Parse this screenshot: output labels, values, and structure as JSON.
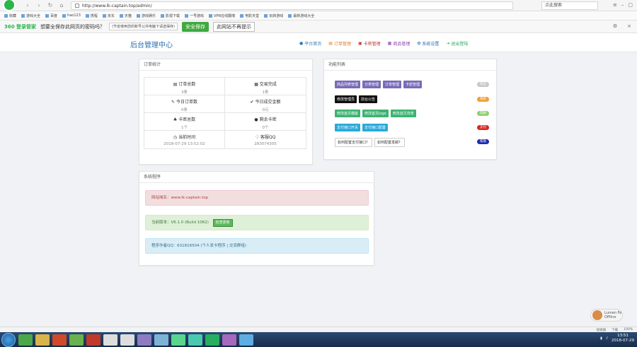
{
  "browser": {
    "url": "http://www.lk-captain.top/admin/",
    "search_placeholder": "点此搜索",
    "bookmarks": [
      "收藏",
      "游戏大全",
      "百度",
      "hao123",
      "携程",
      "京东",
      "天猫",
      "游戏娱乐",
      "影视下载",
      "一号游戏",
      "VPN在线翻墙",
      "电影天堂",
      "玩转游戏",
      "最新游戏大全"
    ],
    "password_bar": {
      "brand": "360 登录管家",
      "question": "想要全保存此网页的密码吗？",
      "hint": "(节省使用您的账号公共电脑下请选保存)",
      "save_label": "安全保存",
      "never_label": "此网站不再提示"
    },
    "zoom": "100%",
    "status_text": "加速器",
    "downloads": "下载"
  },
  "admin": {
    "title": "后台管理中心",
    "nav": [
      {
        "label": "平台首页",
        "color": "#337ab7",
        "icon": "user-icon"
      },
      {
        "label": "订单管理",
        "color": "#e67e22",
        "icon": "order-icon"
      },
      {
        "label": "卡密管理",
        "color": "#c0392b",
        "icon": "card-icon"
      },
      {
        "label": "商品管理",
        "color": "#8e44ad",
        "icon": "goods-icon"
      },
      {
        "label": "系统设置",
        "color": "#2c6fb1",
        "icon": "gear-icon"
      },
      {
        "label": "退出登陆",
        "color": "#27ae60",
        "icon": "logout-icon"
      }
    ]
  },
  "orders_panel": {
    "title": "订单统计",
    "stats": [
      {
        "label": "订单总数",
        "value": "3条",
        "icon": "list-icon"
      },
      {
        "label": "交易完成",
        "value": "1条",
        "icon": "cart-icon"
      },
      {
        "label": "今日订单数",
        "value": "0条",
        "icon": "pen-icon"
      },
      {
        "label": "今日成交金额",
        "value": "0元",
        "icon": "check-icon"
      },
      {
        "label": "卡密总数",
        "value": "1个",
        "icon": "card-icon"
      },
      {
        "label": "剩余卡密",
        "value": "0个",
        "icon": "dot-icon"
      },
      {
        "label": "当前时间",
        "value": "2018-07-29 13:52:02",
        "icon": "clock-icon"
      },
      {
        "label": "客服QQ",
        "value": "283074305",
        "icon": "heart-icon"
      }
    ]
  },
  "functions_panel": {
    "title": "功能列表",
    "rows": [
      {
        "buttons": [
          {
            "label": "商品列表管理",
            "color": "#7a6bb8"
          },
          {
            "label": "分类管理",
            "color": "#7a6bb8"
          },
          {
            "label": "订单管理",
            "color": "#7a6bb8"
          },
          {
            "label": "卡密管理",
            "color": "#7a6bb8"
          }
        ],
        "badge": "商品",
        "badge_color": "#c8c8c8"
      },
      {
        "buttons": [
          {
            "label": "修改管理员",
            "color": "#111111"
          },
          {
            "label": "前台公告",
            "color": "#111111"
          }
        ],
        "badge": "系统",
        "badge_color": "#f0a030"
      },
      {
        "buttons": [
          {
            "label": "修改首页模版",
            "color": "#3cb371"
          },
          {
            "label": "修改首页logo",
            "color": "#3cb371"
          },
          {
            "label": "修改首页背景",
            "color": "#3cb371"
          }
        ],
        "badge": "风格",
        "badge_color": "#8fcf6f"
      },
      {
        "buttons": [
          {
            "label": "支付接口开关",
            "color": "#29a9d8"
          },
          {
            "label": "支付接口配置",
            "color": "#29a9d8"
          }
        ],
        "badge": "支付",
        "badge_color": "#d9281f"
      },
      {
        "buttons": [
          {
            "label": "如何配置支付接口？",
            "color": "#ffffff"
          },
          {
            "label": "如何配置发邮？",
            "color": "#ffffff"
          }
        ],
        "badge": "帮助",
        "badge_color": "#1f2bb0"
      }
    ]
  },
  "sysinfo_panel": {
    "title": "系统程序",
    "domain_text": "网站域名：www.lk-captain.top",
    "version_text": "当前版本：V6.1.0 (Build 1062)",
    "update_label": "检查更新",
    "author_text": "程序作者QQ：631816504 (个人发卡程序 | 交流群组)"
  },
  "float_widget": {
    "line1": "Lumen Fe",
    "line2": "Offline"
  },
  "clock": {
    "time": "13:51",
    "date": "2018-07-29"
  }
}
